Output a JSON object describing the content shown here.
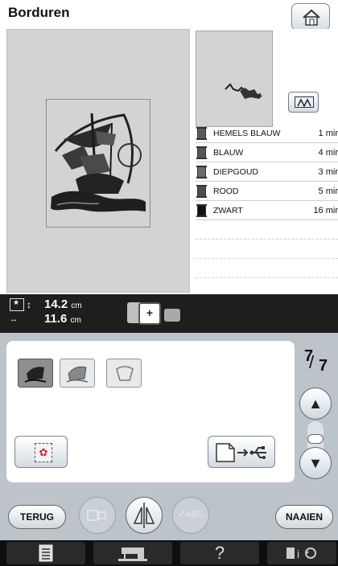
{
  "header": {
    "title": "Borduren"
  },
  "threads": [
    {
      "name": "HEMELS BLAUW",
      "time": "1 mir",
      "color": "#5a5a5a"
    },
    {
      "name": "BLAUW",
      "time": "4 mir",
      "color": "#555555"
    },
    {
      "name": "DIEPGOUD",
      "time": "3 mir",
      "color": "#6a6a6a"
    },
    {
      "name": "ROOD",
      "time": "5 mir",
      "color": "#4d4d4d"
    },
    {
      "name": "ZWART",
      "time": "16 mir",
      "color": "#111111"
    }
  ],
  "size": {
    "height_value": "14.2",
    "width_value": "11.6",
    "unit": "cm"
  },
  "frame": {
    "symbol": "+"
  },
  "pagination": {
    "current": "7",
    "total": "7"
  },
  "buttons": {
    "back": "TERUG",
    "sew": "NAAIEN",
    "abc": "ABC"
  },
  "colors": {
    "accent": "#bcc3c9",
    "infobar": "#1e1e1e",
    "taskbar": "#0e0e0e"
  }
}
